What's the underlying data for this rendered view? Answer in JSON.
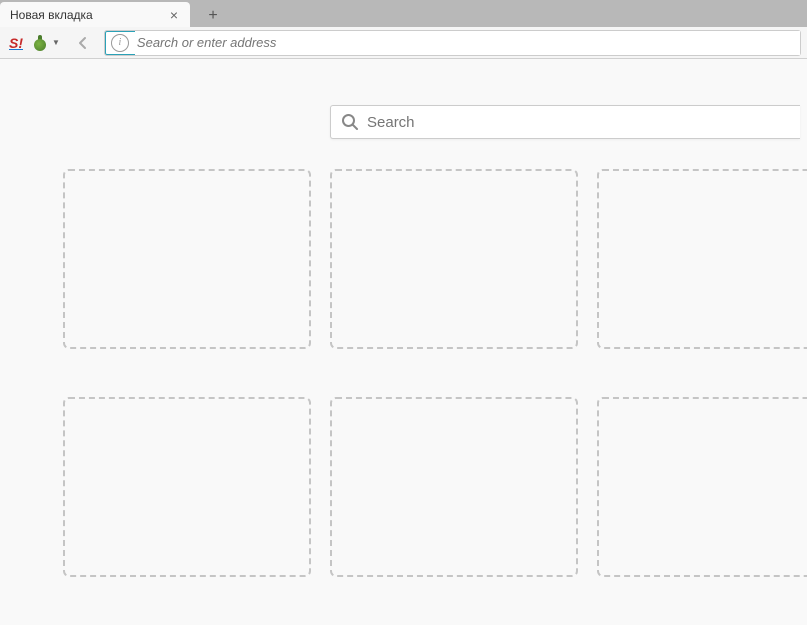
{
  "tab": {
    "title": "Новая вкладка"
  },
  "urlbar": {
    "placeholder": "Search or enter address"
  },
  "search": {
    "placeholder": "Search"
  }
}
